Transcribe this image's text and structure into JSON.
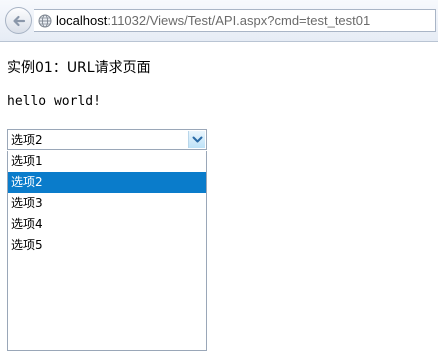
{
  "browser": {
    "back_icon": "back-arrow-icon",
    "site_icon": "globe-icon",
    "url_host": "localhost",
    "url_rest": ":11032/Views/Test/API.aspx?cmd=test_test01"
  },
  "page": {
    "title": "实例01：URL请求页面",
    "message": "hello world!"
  },
  "select": {
    "selected_label": "选项2",
    "arrow_icon": "chevron-down-icon",
    "options": [
      "选项1",
      "选项2",
      "选项3",
      "选项4",
      "选项5"
    ],
    "highlighted_index": 1
  },
  "colors": {
    "highlight": "#0a7ccb",
    "highlight_text": "#ffffff"
  }
}
